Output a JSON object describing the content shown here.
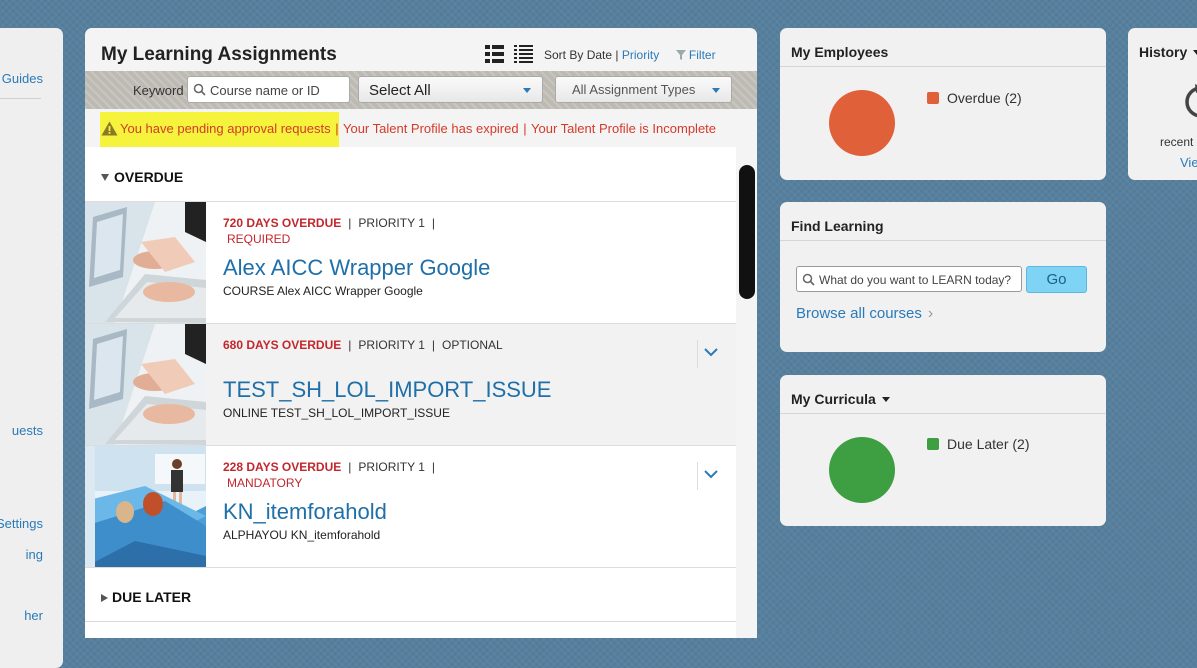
{
  "left_nav": {
    "items": [
      {
        "label": "Guides"
      },
      {
        "label": "uests"
      },
      {
        "label": "Settings"
      },
      {
        "label": "ing"
      },
      {
        "label": "her"
      }
    ]
  },
  "main": {
    "title": "My Learning Assignments",
    "sort": {
      "prefix": "Sort By",
      "date": "Date",
      "separator": "|",
      "priority": "Priority"
    },
    "filter_label": "Filter",
    "search": {
      "keyword_label": "Keyword",
      "placeholder": "Course name or ID",
      "select_value": "Select All",
      "type_value": "All Assignment Types"
    },
    "alerts": [
      "You have pending approval requests",
      "Your Talent Profile has expired",
      "Your Talent Profile is Incomplete"
    ],
    "alert_separator": "|",
    "sections": {
      "overdue": "OVERDUE",
      "due_later": "DUE LATER"
    },
    "rows": [
      {
        "overdue": "720 DAYS OVERDUE",
        "priority": "PRIORITY 1",
        "flag": "REQUIRED",
        "title": "Alex AICC Wrapper Google",
        "subtitle": "COURSE Alex AICC Wrapper Google"
      },
      {
        "overdue": "680 DAYS OVERDUE",
        "priority": "PRIORITY 1",
        "flag": "OPTIONAL",
        "title": "TEST_SH_LOL_IMPORT_ISSUE",
        "subtitle": "ONLINE TEST_SH_LOL_IMPORT_ISSUE"
      },
      {
        "overdue": "228 DAYS OVERDUE",
        "priority": "PRIORITY 1",
        "flag": "MANDATORY",
        "title": "KN_itemforahold",
        "subtitle": "ALPHAYOU KN_itemforahold"
      }
    ],
    "pipe": "|"
  },
  "my_employees": {
    "title": "My Employees",
    "legend": "Overdue (2)",
    "color": "#e0603a"
  },
  "find_learning": {
    "title": "Find Learning",
    "placeholder": "What do you want to LEARN today?",
    "go_label": "Go",
    "browse_label": "Browse all courses",
    "browse_chevron": "›"
  },
  "my_curricula": {
    "title": "My Curricula",
    "legend": "Due Later (2)",
    "color": "#3d9e42"
  },
  "history": {
    "title": "History",
    "recent_label": "recent",
    "view_label": "Vie"
  },
  "colors": {
    "accent_link": "#2a7ab8",
    "overdue_red": "#c1272d",
    "highlight": "#f6f33c"
  }
}
